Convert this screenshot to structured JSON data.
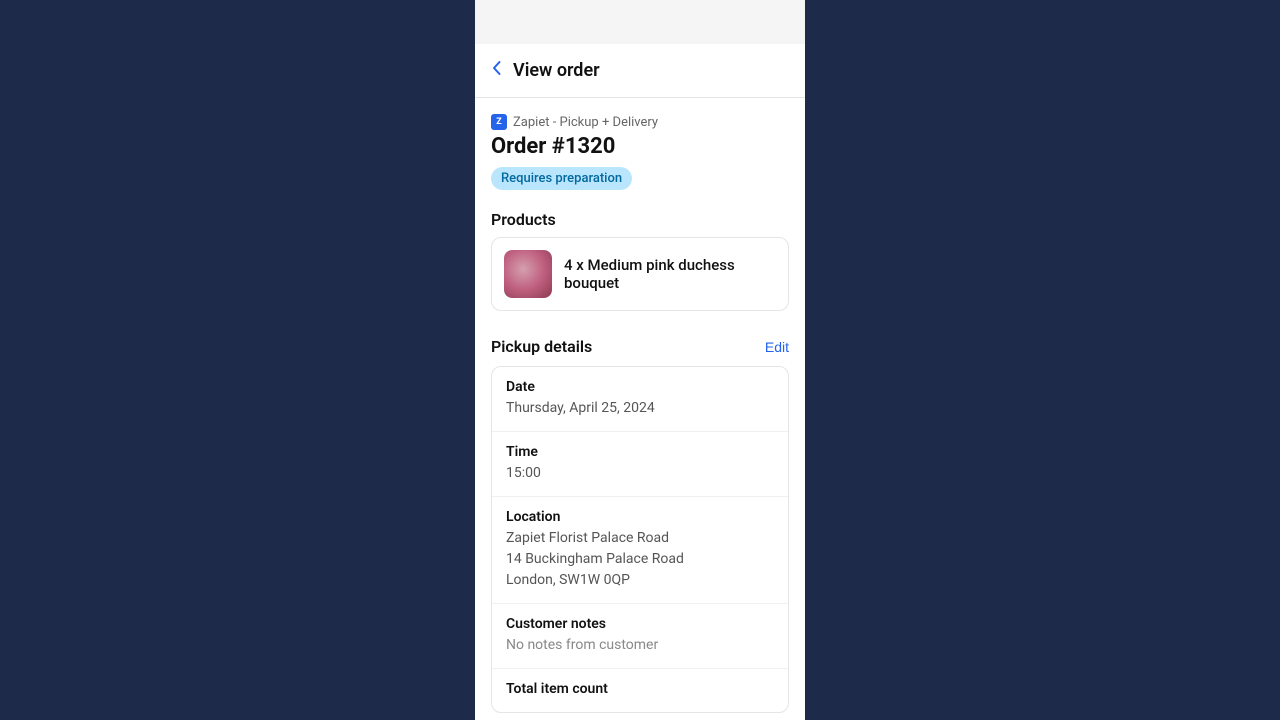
{
  "colors": {
    "background": "#1e2a4a",
    "accent": "#2563eb",
    "badge_preparation_bg": "#bae6fd",
    "badge_preparation_text": "#0369a1"
  },
  "nav": {
    "back_label": "Back",
    "title": "View order"
  },
  "order": {
    "source": "Zapiet - Pickup + Delivery",
    "source_icon": "Z",
    "number": "Order #1320",
    "badge": "Requires preparation"
  },
  "products": {
    "section_title": "Products",
    "items": [
      {
        "quantity": "4",
        "name": "Medium pink duchess bouquet"
      }
    ]
  },
  "pickup": {
    "section_title": "Pickup details",
    "edit_label": "Edit",
    "details": [
      {
        "label": "Date",
        "value": "Thursday, April 25, 2024"
      },
      {
        "label": "Time",
        "value": "15:00"
      },
      {
        "label": "Location",
        "value": "Zapiet Florist Palace Road\n14 Buckingham Palace Road\nLondon, SW1W 0QP"
      },
      {
        "label": "Customer notes",
        "value": "No notes from customer"
      },
      {
        "label": "Total item count",
        "value": ""
      }
    ]
  }
}
